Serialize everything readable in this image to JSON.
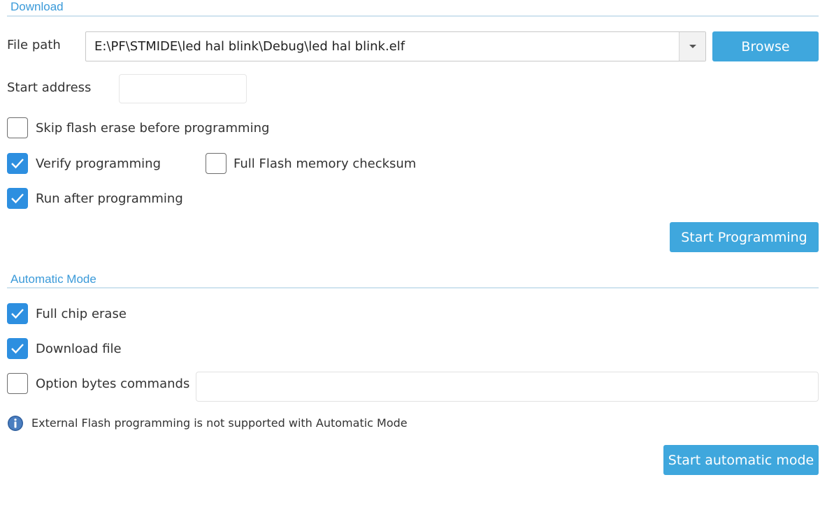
{
  "download": {
    "title": "Download",
    "file_path_label": "File path",
    "file_path_value": "E:\\PF\\STMIDE\\led hal blink\\Debug\\led hal blink.elf",
    "browse_label": "Browse",
    "start_address_label": "Start address",
    "start_address_value": "",
    "skip_flash_erase": {
      "label": "Skip flash erase before programming",
      "checked": false
    },
    "verify_programming": {
      "label": "Verify programming",
      "checked": true
    },
    "full_flash_checksum": {
      "label": "Full Flash memory checksum",
      "checked": false
    },
    "run_after_programming": {
      "label": "Run after programming",
      "checked": true
    },
    "start_programming_label": "Start Programming"
  },
  "automatic_mode": {
    "title": "Automatic Mode",
    "full_chip_erase": {
      "label": "Full chip erase",
      "checked": true
    },
    "download_file": {
      "label": "Download file",
      "checked": true
    },
    "option_bytes_commands": {
      "label": "Option bytes commands",
      "checked": false
    },
    "option_bytes_value": "",
    "info_text": "External Flash programming is not supported with Automatic Mode",
    "start_automatic_label": "Start automatic mode"
  },
  "icons": {
    "info": "info-icon",
    "dropdown": "chevron-down-icon",
    "check": "check-icon"
  },
  "colors": {
    "accent": "#3fa7dd",
    "checkbox_checked": "#2d8fe0",
    "section_title": "#3a9ad9"
  }
}
